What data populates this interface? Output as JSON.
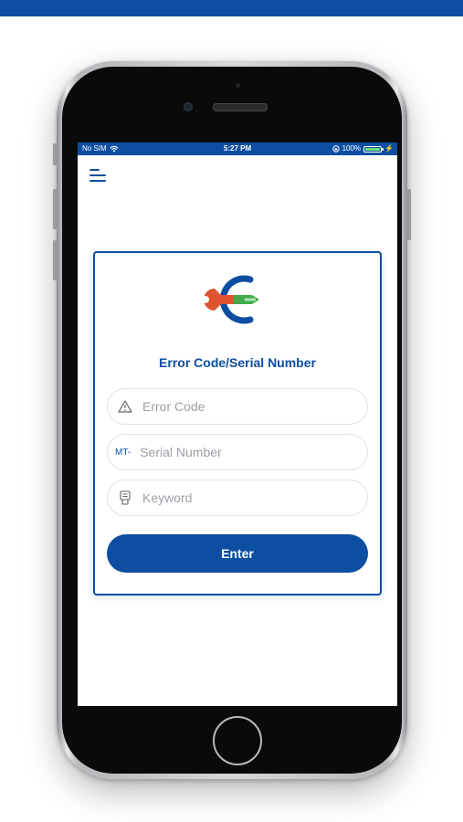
{
  "status_bar": {
    "carrier": "No SIM",
    "time": "5:27 PM",
    "battery_percent": "100%",
    "icons": [
      "wifi-icon",
      "orientation-lock-icon",
      "battery-icon",
      "charging-bolt-icon"
    ]
  },
  "header": {
    "menu_icon": "hamburger-menu-icon"
  },
  "card": {
    "title": "Error Code/Serial Number",
    "fields": [
      {
        "icon": "warning-triangle-icon",
        "placeholder": "Error Code"
      },
      {
        "prefix": "MT-",
        "placeholder": "Serial Number"
      },
      {
        "icon": "keyword-tag-icon",
        "placeholder": "Keyword"
      }
    ],
    "button_label": "Enter"
  },
  "colors": {
    "brand_blue": "#0c4ea2",
    "logo_red": "#e0532f",
    "logo_green": "#3fae49",
    "battery_green": "#6ee36e"
  }
}
